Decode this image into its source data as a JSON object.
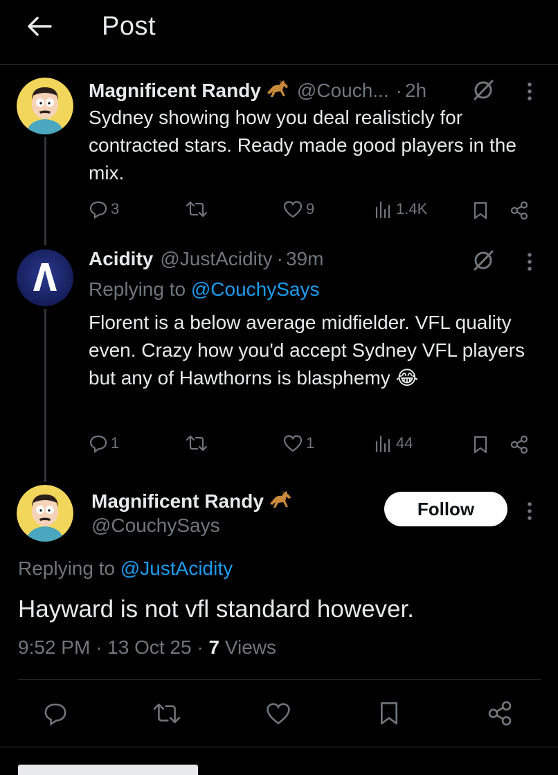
{
  "header": {
    "title": "Post"
  },
  "tweet1": {
    "name": "Magnificent Randy",
    "handle": "@Couch...",
    "dot": "·",
    "time": "2h",
    "text": "Sydney showing how you deal realisticly for contracted stars. Ready made good players in the mix.",
    "replies": "3",
    "likes": "9",
    "views": "1.4K"
  },
  "tweet2": {
    "name": "Acidity",
    "handle": "@JustAcidity",
    "dot": "·",
    "time": "39m",
    "replying_prefix": "Replying to ",
    "replying_mention": "@CouchySays",
    "text": "Florent is a below average midfielder. VFL quality even. Crazy how you'd accept Sydney VFL players but any of Hawthorns is blasphemy 😂",
    "replies": "1",
    "likes": "1",
    "views": "44"
  },
  "main": {
    "name": "Magnificent Randy",
    "handle": "@CouchySays",
    "follow_label": "Follow",
    "replying_prefix": "Replying to ",
    "replying_mention": "@JustAcidity",
    "text": "Hayward is not vfl standard however.",
    "time": "9:52 PM",
    "date": "13 Oct 25",
    "views_count": "7",
    "views_label": "Views",
    "sep": "·"
  },
  "colors": {
    "background": "#000000",
    "text": "#e7e9ea",
    "muted": "#71767b",
    "link": "#1d9bf0",
    "divider": "#2f3336"
  }
}
